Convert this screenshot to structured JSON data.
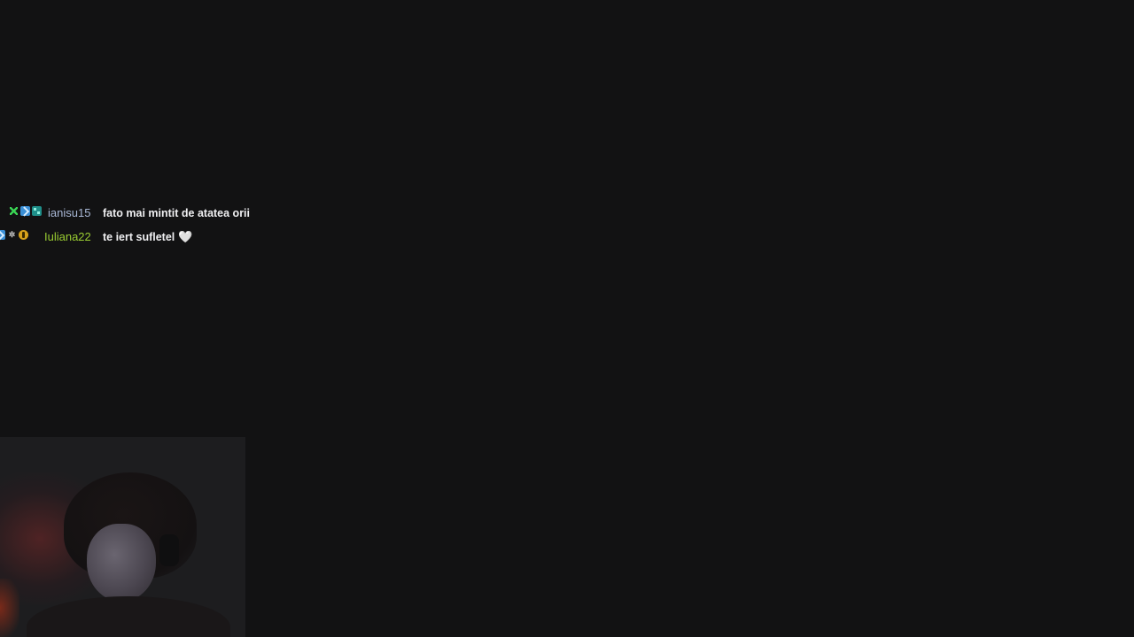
{
  "chat": {
    "messages": [
      {
        "badges": [
          "green-k-badge-icon",
          "blue-arrow-badge-icon",
          "teal-grid-badge-icon"
        ],
        "username": "ianisu15",
        "username_color": "#a9b8d6",
        "text": "fato mai mintit de atatea orii"
      },
      {
        "badges": [
          "blue-arrow-badge-icon",
          "star-badge-icon",
          "gold-exclamation-badge-icon"
        ],
        "username": "Iuliana22",
        "username_color": "#9acd32",
        "text": "te iert sufletel",
        "emoji": "🤍"
      }
    ]
  },
  "colors": {
    "background": "#121213",
    "message_text": "#efeff1"
  }
}
